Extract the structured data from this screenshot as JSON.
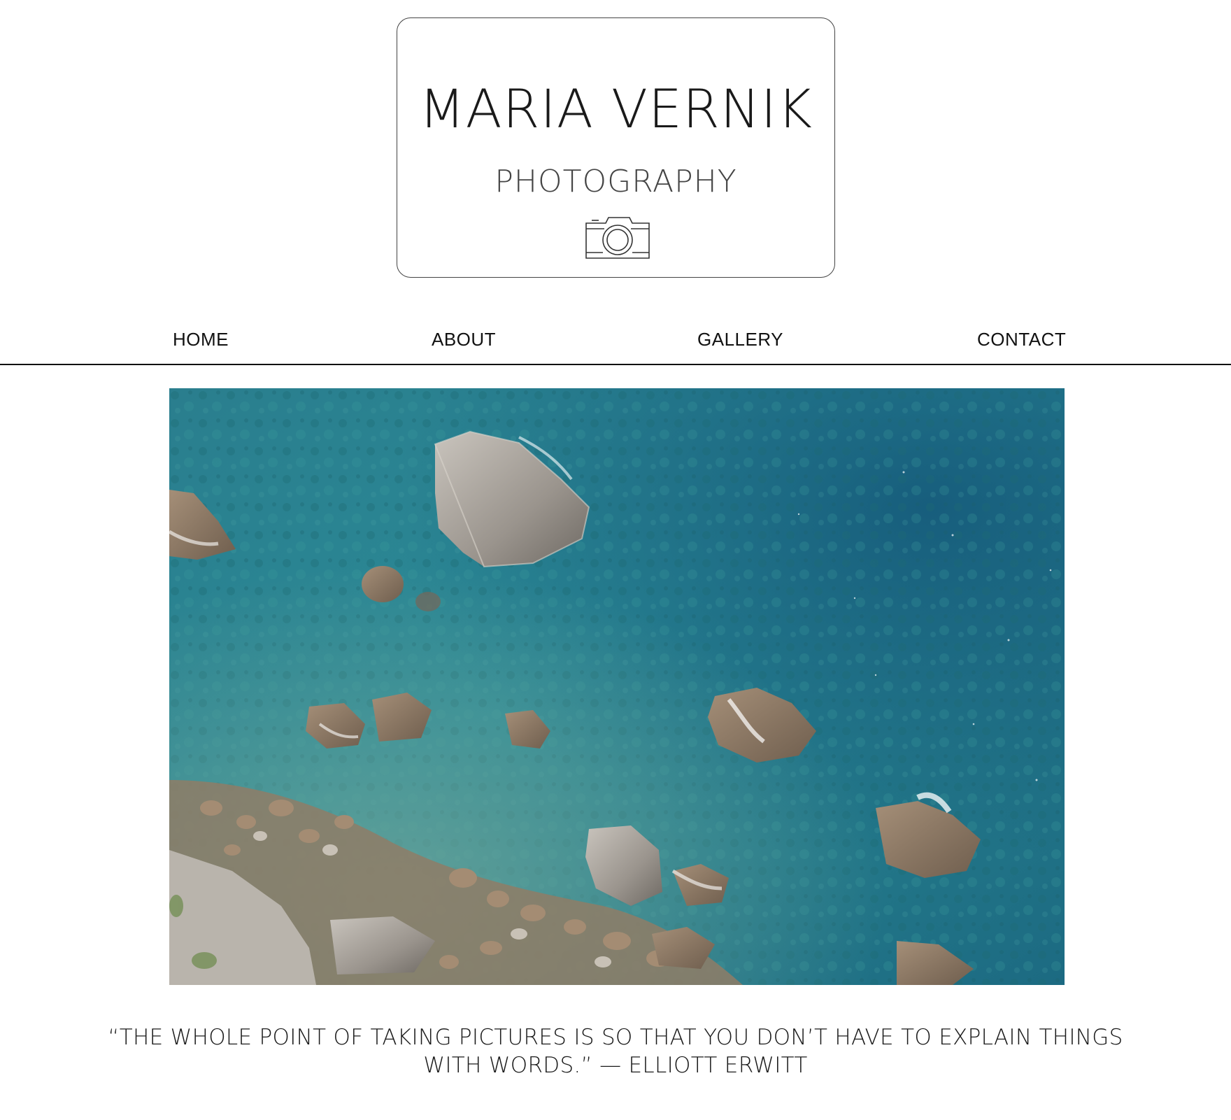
{
  "logo": {
    "title": "MARIA VERNIK",
    "subtitle": "PHOTOGRAPHY",
    "icon": "camera-icon"
  },
  "nav": {
    "items": [
      {
        "label": "HOME"
      },
      {
        "label": "ABOUT"
      },
      {
        "label": "GALLERY"
      },
      {
        "label": "CONTACT"
      }
    ]
  },
  "hero": {
    "description_icon": "photo",
    "colors": {
      "water_deep": "#1f6f86",
      "water_shallow": "#2f8f98",
      "rock": "#8a8580",
      "rock_light": "#b9b4ae",
      "shore": "#9c8a72"
    }
  },
  "quote": {
    "line1": "“THE WHOLE POINT OF TAKING PICTURES IS SO THAT YOU DON’T HAVE TO EXPLAIN THINGS",
    "line2": "WITH WORDS.” — ELLIOTT ERWITT"
  }
}
